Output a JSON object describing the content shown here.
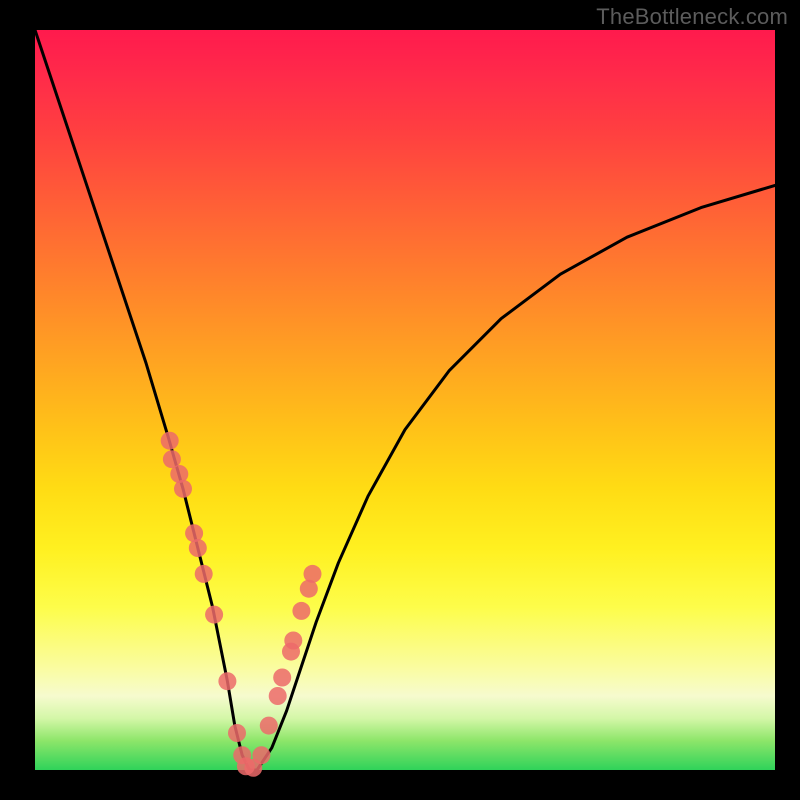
{
  "attribution": "TheBottleneck.com",
  "chart_data": {
    "type": "line",
    "title": "",
    "xlabel": "",
    "ylabel": "",
    "xlim": [
      0,
      100
    ],
    "ylim": [
      0,
      100
    ],
    "series": [
      {
        "name": "bottleneck-curve",
        "x": [
          0,
          3,
          6,
          9,
          12,
          15,
          18,
          20,
          22,
          24,
          26,
          27,
          28,
          29,
          30,
          32,
          34,
          36,
          38,
          41,
          45,
          50,
          56,
          63,
          71,
          80,
          90,
          100
        ],
        "y": [
          100,
          91,
          82,
          73,
          64,
          55,
          45,
          38,
          30,
          22,
          12,
          6,
          2,
          0,
          0,
          3,
          8,
          14,
          20,
          28,
          37,
          46,
          54,
          61,
          67,
          72,
          76,
          79
        ]
      }
    ],
    "markers": {
      "name": "highlight-dots",
      "color": "#ec6a6a",
      "x": [
        18.2,
        18.5,
        19.5,
        20.0,
        21.5,
        22.0,
        22.8,
        24.2,
        26.0,
        27.3,
        28.0,
        28.5,
        29.5,
        30.6,
        31.6,
        32.8,
        33.4,
        34.6,
        34.9,
        36.0,
        37.0,
        37.5
      ],
      "y": [
        44.5,
        42.0,
        40.0,
        38.0,
        32.0,
        30.0,
        26.5,
        21.0,
        12.0,
        5.0,
        2.0,
        0.5,
        0.3,
        2.0,
        6.0,
        10.0,
        12.5,
        16.0,
        17.5,
        21.5,
        24.5,
        26.5
      ]
    }
  },
  "colors": {
    "curve": "#000000",
    "marker_fill": "#ec6a6a",
    "marker_stroke": "#b94646",
    "background_frame": "#000000"
  }
}
